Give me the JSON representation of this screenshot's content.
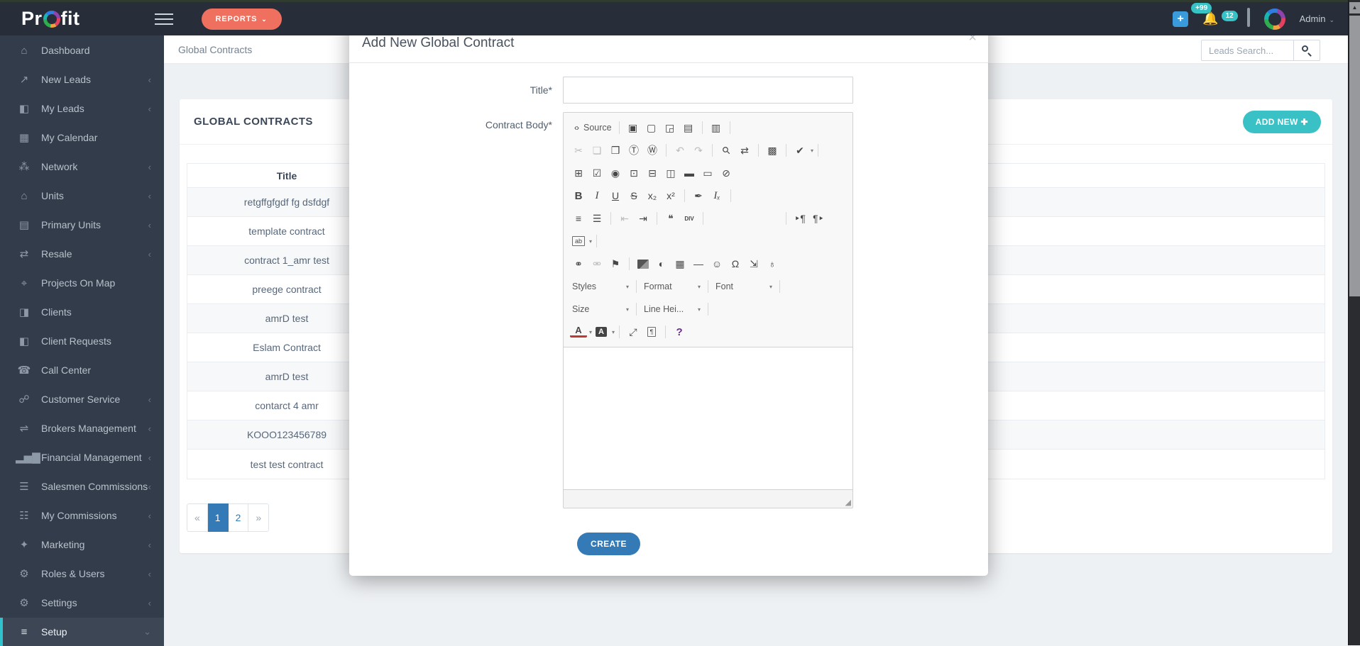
{
  "navbar": {
    "logo_pre": "Pr",
    "logo_post": "fit",
    "reports_label": "REPORTS",
    "reports_caret": "⌄",
    "plus_glyph": "+",
    "notifications_badge": "+99",
    "messages_badge": "12",
    "admin_label": "Admin",
    "admin_caret": "⌄"
  },
  "sidebar": {
    "items": [
      {
        "label": "Dashboard",
        "icon": "home-icon",
        "glyph": "⌂",
        "expandable": false,
        "active": false
      },
      {
        "label": "New Leads",
        "icon": "chart-line-icon",
        "glyph": "↗",
        "expandable": true,
        "active": false
      },
      {
        "label": "My Leads",
        "icon": "contact-card-icon",
        "glyph": "◧",
        "expandable": true,
        "active": false
      },
      {
        "label": "My Calendar",
        "icon": "calendar-icon",
        "glyph": "▦",
        "expandable": false,
        "active": false
      },
      {
        "label": "Network",
        "icon": "users-icon",
        "glyph": "⁂",
        "expandable": true,
        "active": false
      },
      {
        "label": "Units",
        "icon": "home-icon",
        "glyph": "⌂",
        "expandable": true,
        "active": false
      },
      {
        "label": "Primary Units",
        "icon": "building-icon",
        "glyph": "▤",
        "expandable": true,
        "active": false
      },
      {
        "label": "Resale",
        "icon": "exchange-icon",
        "glyph": "⇄",
        "expandable": true,
        "active": false
      },
      {
        "label": "Projects On Map",
        "icon": "map-marker-icon",
        "glyph": "⌖",
        "expandable": false,
        "active": false
      },
      {
        "label": "Clients",
        "icon": "id-badge-icon",
        "glyph": "◨",
        "expandable": false,
        "active": false
      },
      {
        "label": "Client Requests",
        "icon": "id-badge-icon",
        "glyph": "◧",
        "expandable": false,
        "active": false
      },
      {
        "label": "Call Center",
        "icon": "phone-icon",
        "glyph": "☎",
        "expandable": false,
        "active": false
      },
      {
        "label": "Customer Service",
        "icon": "handshake-icon",
        "glyph": "☍",
        "expandable": true,
        "active": false
      },
      {
        "label": "Brokers Management",
        "icon": "shuffle-icon",
        "glyph": "⇌",
        "expandable": true,
        "active": false
      },
      {
        "label": "Financial Management",
        "icon": "bar-chart-icon",
        "glyph": "▂▅▇",
        "expandable": true,
        "active": false
      },
      {
        "label": "Salesmen Commissions",
        "icon": "cash-icon",
        "glyph": "☰",
        "expandable": true,
        "active": false
      },
      {
        "label": "My Commissions",
        "icon": "cash-icon",
        "glyph": "☷",
        "expandable": true,
        "active": false
      },
      {
        "label": "Marketing",
        "icon": "cart-icon",
        "glyph": "✦",
        "expandable": true,
        "active": false
      },
      {
        "label": "Roles & Users",
        "icon": "gears-icon",
        "glyph": "⚙",
        "expandable": true,
        "active": false
      },
      {
        "label": "Settings",
        "icon": "gear-icon",
        "glyph": "⚙",
        "expandable": true,
        "active": false
      },
      {
        "label": "Setup",
        "icon": "sliders-icon",
        "glyph": "≡",
        "expandable": true,
        "active": true
      }
    ],
    "chevron_collapsed": "‹",
    "chevron_expanded": "⌄"
  },
  "breadcrumb": "Global Contracts",
  "search": {
    "placeholder": "Leads Search..."
  },
  "panel": {
    "title": "GLOBAL CONTRACTS",
    "add_button_label": "ADD NEW",
    "add_button_plus": "✚",
    "table": {
      "header": "Title",
      "rows": [
        "retgffgfgdf fg dsfdgf",
        "template contract",
        "contract 1_amr test",
        "preege contract",
        "amrD test",
        "Eslam Contract",
        "amrD test",
        "contarct 4 amr",
        "KOOO123456789",
        "test test contract"
      ]
    },
    "pagination": {
      "prev": "«",
      "pages": [
        "1",
        "2"
      ],
      "next": "»",
      "active": "1"
    }
  },
  "modal": {
    "title": "Add New Global Contract",
    "close_glyph": "×",
    "title_label": "Title*",
    "title_value": "",
    "body_label": "Contract Body*",
    "create_label": "CREATE",
    "editor": {
      "combos": {
        "styles": "Styles",
        "format": "Format",
        "font": "Font",
        "size": "Size",
        "lineheight": "Line Hei..."
      },
      "rows": [
        [
          {
            "k": "icon",
            "n": "source-icon",
            "g": "‹›",
            "c": "src"
          },
          {
            "k": "label",
            "n": "source-label",
            "text": "Source"
          },
          {
            "k": "sep"
          },
          {
            "k": "icon",
            "n": "save-icon",
            "g": "▣"
          },
          {
            "k": "icon",
            "n": "new-page-icon",
            "g": "▢"
          },
          {
            "k": "icon",
            "n": "preview-icon",
            "g": "◲"
          },
          {
            "k": "icon",
            "n": "print-icon",
            "g": "▤"
          },
          {
            "k": "sep"
          },
          {
            "k": "icon",
            "n": "templates-icon",
            "g": "▥"
          },
          {
            "k": "sep"
          }
        ],
        [
          {
            "k": "icon",
            "n": "cut-icon",
            "g": "✂",
            "d": true
          },
          {
            "k": "icon",
            "n": "copy-icon",
            "g": "❏",
            "d": true
          },
          {
            "k": "icon",
            "n": "paste-icon",
            "g": "❒"
          },
          {
            "k": "icon",
            "n": "paste-text-icon",
            "g": "Ⓣ"
          },
          {
            "k": "icon",
            "n": "paste-word-icon",
            "g": "Ⓦ"
          },
          {
            "k": "sep"
          },
          {
            "k": "icon",
            "n": "undo-icon",
            "g": "↶",
            "d": true
          },
          {
            "k": "icon",
            "n": "redo-icon",
            "g": "↷",
            "d": true
          },
          {
            "k": "sep"
          },
          {
            "k": "icon",
            "n": "find-icon",
            "g": "⚲",
            "c": "rot"
          },
          {
            "k": "icon",
            "n": "replace-icon",
            "g": "⇄"
          },
          {
            "k": "sep"
          },
          {
            "k": "icon",
            "n": "select-all-icon",
            "g": "▩"
          },
          {
            "k": "sep"
          },
          {
            "k": "icon",
            "n": "spellcheck-icon",
            "g": "✔"
          },
          {
            "k": "caret"
          },
          {
            "k": "sep"
          }
        ],
        [
          {
            "k": "icon",
            "n": "form-icon",
            "g": "⊞"
          },
          {
            "k": "icon",
            "n": "checkbox-icon",
            "g": "☑"
          },
          {
            "k": "icon",
            "n": "radio-button-icon",
            "g": "◉"
          },
          {
            "k": "icon",
            "n": "text-field-icon",
            "g": "⊡"
          },
          {
            "k": "icon",
            "n": "textarea-icon",
            "g": "⊟"
          },
          {
            "k": "icon",
            "n": "select-field-icon",
            "g": "◫"
          },
          {
            "k": "icon",
            "n": "button-icon",
            "g": "▬"
          },
          {
            "k": "icon",
            "n": "image-button-icon",
            "g": "▭"
          },
          {
            "k": "icon",
            "n": "hidden-field-icon",
            "g": "⊘"
          }
        ],
        [
          {
            "k": "icon",
            "n": "bold-icon",
            "g": "B",
            "c": "bld"
          },
          {
            "k": "icon",
            "n": "italic-icon",
            "g": "I",
            "c": "itl"
          },
          {
            "k": "icon",
            "n": "underline-icon",
            "g": "U",
            "c": "und"
          },
          {
            "k": "icon",
            "n": "strikethrough-icon",
            "g": "S",
            "c": "stk"
          },
          {
            "k": "icon",
            "n": "subscript-icon",
            "g": "x₂"
          },
          {
            "k": "icon",
            "n": "superscript-icon",
            "g": "x²"
          },
          {
            "k": "sep"
          },
          {
            "k": "icon",
            "n": "copy-formatting-icon",
            "g": "✒"
          },
          {
            "k": "icon",
            "n": "remove-format-icon",
            "g": "Iₓ",
            "c": "itl"
          },
          {
            "k": "sep"
          }
        ],
        [
          {
            "k": "icon",
            "n": "numbered-list-icon",
            "g": "≡"
          },
          {
            "k": "icon",
            "n": "bulleted-list-icon",
            "g": "☰"
          },
          {
            "k": "sep"
          },
          {
            "k": "icon",
            "n": "outdent-icon",
            "g": "⇤",
            "d": true
          },
          {
            "k": "icon",
            "n": "indent-icon",
            "g": "⇥"
          },
          {
            "k": "sep"
          },
          {
            "k": "icon",
            "n": "blockquote-icon",
            "g": "❝"
          },
          {
            "k": "icon",
            "n": "div-container-icon",
            "g": "DIV",
            "c": "txt"
          },
          {
            "k": "sep"
          },
          {
            "k": "icon",
            "n": "align-left-icon",
            "g": "",
            "c": "al l"
          },
          {
            "k": "icon",
            "n": "align-center-icon",
            "g": "",
            "c": "al c"
          },
          {
            "k": "icon",
            "n": "align-right-icon",
            "g": "",
            "c": "al r"
          },
          {
            "k": "icon",
            "n": "align-justify-icon",
            "g": "",
            "c": "al j"
          },
          {
            "k": "sep"
          },
          {
            "k": "icon",
            "n": "bidi-ltr-icon",
            "g": "‣¶"
          },
          {
            "k": "icon",
            "n": "bidi-rtl-icon",
            "g": "¶‣"
          }
        ],
        [
          {
            "k": "icon",
            "n": "language-icon",
            "g": "ab",
            "c": "bx",
            "wrap": true
          },
          {
            "k": "caret"
          },
          {
            "k": "sep"
          }
        ],
        [
          {
            "k": "icon",
            "n": "link-icon",
            "g": "⚭"
          },
          {
            "k": "icon",
            "n": "unlink-icon",
            "g": "⚮",
            "d": true
          },
          {
            "k": "icon",
            "n": "anchor-icon",
            "g": "⚑"
          },
          {
            "k": "sep"
          },
          {
            "k": "icon",
            "n": "image-icon",
            "g": "",
            "c": "pic",
            "wrap": true
          },
          {
            "k": "icon",
            "n": "flash-icon",
            "g": "◐"
          },
          {
            "k": "icon",
            "n": "table-icon",
            "g": "▦"
          },
          {
            "k": "icon",
            "n": "horizontal-rule-icon",
            "g": "—"
          },
          {
            "k": "icon",
            "n": "smiley-icon",
            "g": "☺"
          },
          {
            "k": "icon",
            "n": "special-char-icon",
            "g": "Ω"
          },
          {
            "k": "icon",
            "n": "page-break-icon",
            "g": "⇲"
          },
          {
            "k": "icon",
            "n": "iframe-icon",
            "g": "♁"
          }
        ],
        [
          {
            "k": "combo",
            "n": "styles-combo",
            "bind": "styles"
          },
          {
            "k": "sep"
          },
          {
            "k": "combo",
            "n": "format-combo",
            "bind": "format"
          },
          {
            "k": "sep"
          },
          {
            "k": "combo",
            "n": "font-combo",
            "bind": "font"
          },
          {
            "k": "sep"
          }
        ],
        [
          {
            "k": "combo",
            "n": "size-combo",
            "bind": "size"
          },
          {
            "k": "sep"
          },
          {
            "k": "combo",
            "n": "line-height-combo",
            "bind": "lineheight"
          },
          {
            "k": "sep"
          }
        ],
        [
          {
            "k": "icon",
            "n": "text-color-icon",
            "g": "A",
            "c": "tc"
          },
          {
            "k": "caret"
          },
          {
            "k": "icon",
            "n": "bg-color-icon",
            "g": "A",
            "c": "bgc",
            "wrap": true
          },
          {
            "k": "caret"
          },
          {
            "k": "sep"
          },
          {
            "k": "icon",
            "n": "maximize-icon",
            "g": "⤢"
          },
          {
            "k": "icon",
            "n": "show-blocks-icon",
            "g": "¶",
            "c": "bx",
            "wrap": true
          },
          {
            "k": "sep"
          },
          {
            "k": "icon",
            "n": "about-icon",
            "g": "?",
            "c": "abt"
          }
        ]
      ],
      "grip_glyph": "◢"
    }
  }
}
